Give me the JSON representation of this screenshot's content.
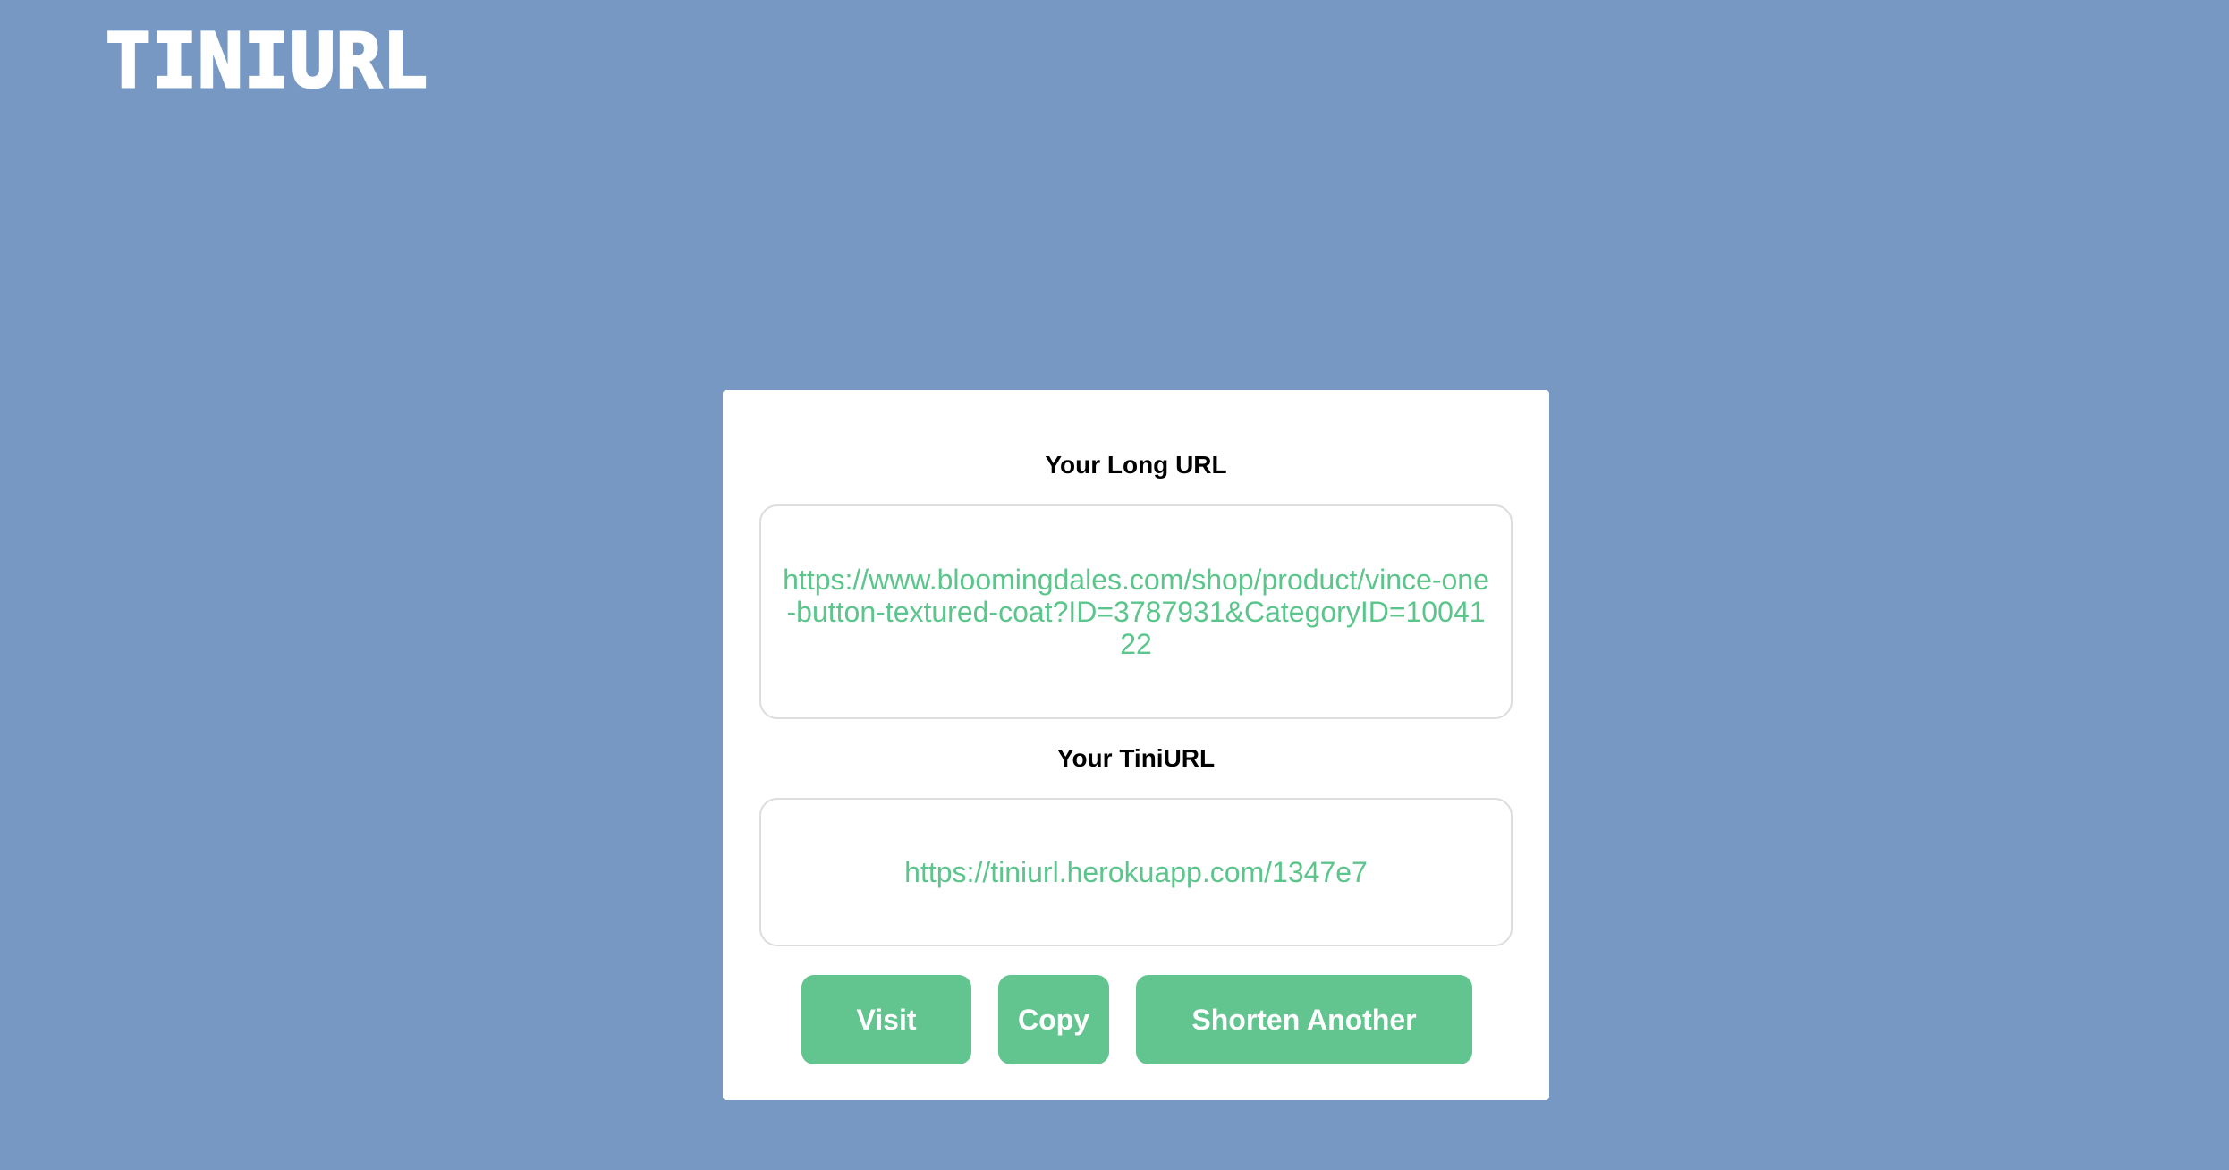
{
  "header": {
    "logo_text": "TINIURL"
  },
  "card": {
    "long_url_label": "Your Long URL",
    "long_url_value": "https://www.bloomingdales.com/shop/product/vince-one-button-textured-coat?ID=3787931&CategoryID=1004122",
    "tini_url_label": "Your TiniURL",
    "tini_url_value": "https://tiniurl.herokuapp.com/1347e7"
  },
  "actions": {
    "visit_label": "Visit",
    "copy_label": "Copy",
    "shorten_another_label": "Shorten Another"
  },
  "colors": {
    "background": "#7698c3",
    "accent": "#62c48e",
    "url_text": "#5cc58c",
    "card": "#ffffff"
  }
}
